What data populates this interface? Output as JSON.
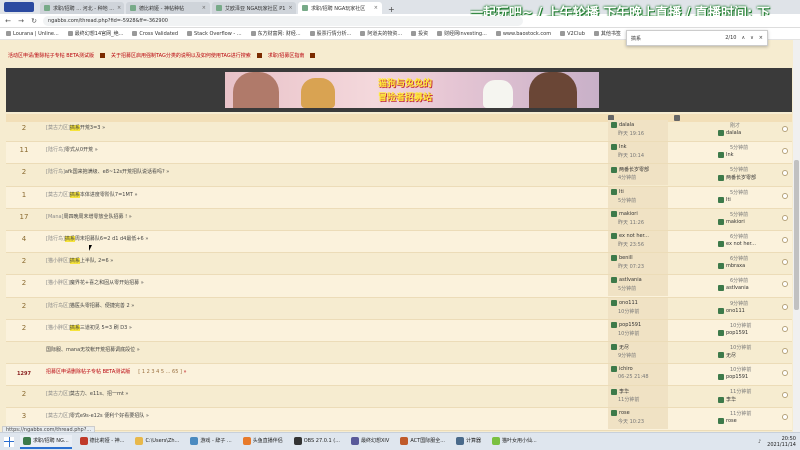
{
  "browser": {
    "tabs": [
      {
        "label": "求职/招聘 ... 河北 - 种地 ...",
        "active": false
      },
      {
        "label": "德比莉娅 - 神帖种帖",
        "active": false
      },
      {
        "label": "艾欧泽亚 NGA玩家社区 P1",
        "active": false
      },
      {
        "label": "求职/招聘 NGA玩家社区",
        "active": true
      }
    ],
    "url": "ngabbs.com/thread.php?fid=-5928&ff=-362900",
    "bookmarks": [
      "Lourana | Unline...",
      "最终幻想14官网_绝...",
      "Cross Validated",
      "Stack Overflow - ...",
      "东方财富网: 财经...",
      "股票行情分析...",
      "阿道夫的物资...",
      "投资",
      "财经网investing...",
      "www.baostock.com",
      "V2Club",
      "其他书签"
    ],
    "find": {
      "query": "搞系",
      "count": "2/10"
    }
  },
  "banner_text": "一起玩吧~ / 上午轮播 下午晚上直播 / 直播时间: 下",
  "forum": {
    "announcements": [
      "活动区申请/删除帖子专帖 BETA测试版",
      "关于招募区启用强制TAG分类的说明以及如何使用TAG进行搜索",
      "求职/招募区指南"
    ],
    "hero": {
      "line1": "猫狗与兔兔的",
      "line2": "冒险者招募站",
      "chip": "广告"
    }
  },
  "threads": [
    {
      "replies": "2",
      "prefix": "[莫古力区]",
      "highlight": "搞系",
      "rest": "开荒3=3",
      "author": "dalala",
      "author_time": "昨天 19:16",
      "reply_time": "刚才",
      "last_reply": "dalala"
    },
    {
      "replies": "11",
      "prefix": "[陆行鸟]",
      "highlight": "",
      "rest": "零式从0开荒",
      "author": "Ink",
      "author_time": "昨天 10:14",
      "reply_time": "5分钟前",
      "last_reply": "Ink"
    },
    {
      "replies": "2",
      "prefix": "[陆行鸟]",
      "highlight": "",
      "rest": "afk国来抱满级、e8~12s开荒招队说话看吗?",
      "author": "两番长岁零部",
      "author_time": "4分钟前",
      "reply_time": "5分钟前",
      "last_reply": "两番长岁零部"
    },
    {
      "replies": "1",
      "prefix": "[莫古力区]",
      "highlight": "搞系",
      "rest": "本体进度零阶队7=1MT",
      "author": "Iti",
      "author_time": "5分钟前",
      "reply_time": "5分钟前",
      "last_reply": "Iti"
    },
    {
      "replies": "17",
      "prefix": "[Mana]",
      "highlight": "",
      "rest": "周四晚周末增零放全队招募 !",
      "author": "makiori",
      "author_time": "昨天 11:26",
      "reply_time": "5分钟前",
      "last_reply": "makiori"
    },
    {
      "replies": "4",
      "prefix": "[陆行鸟]",
      "highlight": "搞系",
      "rest": "周末招募队6=2 d1 d4最低+6",
      "author": "ex not her...",
      "author_time": "昨天 23:56",
      "reply_time": "6分钟前",
      "last_reply": "ex not her..."
    },
    {
      "replies": "2",
      "prefix": "[猫小胖区]",
      "highlight": "搞系",
      "rest": "上半队, 2=6",
      "author": "benill",
      "author_time": "昨天 07:23",
      "reply_time": "6分钟前",
      "last_reply": "mbraxa"
    },
    {
      "replies": "2",
      "prefix": "[猫小胖区]",
      "highlight": "",
      "rest": "魔界花+喜之和固从零开始招募",
      "author": "astlvania",
      "author_time": "5分钟前",
      "reply_time": "6分钟前",
      "last_reply": "astlvania"
    },
    {
      "replies": "2",
      "prefix": "[陆行鸟区]",
      "highlight": "",
      "rest": "猫医头零招募、便捷完善 2",
      "author": "ono111",
      "author_time": "10分钟前",
      "reply_time": "9分钟前",
      "last_reply": "ono111"
    },
    {
      "replies": "2",
      "prefix": "[猫小胖区]",
      "highlight": "搞系",
      "rest": "三道初见 5=3 刷 D3",
      "author": "pop1591",
      "author_time": "10分钟前",
      "reply_time": "10分钟前",
      "last_reply": "pop1591"
    },
    {
      "replies": "",
      "prefix": "",
      "highlight": "",
      "rest": "国际服、mana无坟帐开荒招募调底段位",
      "author": "无尽",
      "author_time": "9分钟前",
      "reply_time": "10分钟前",
      "last_reply": "无尽"
    },
    {
      "replies": "1297",
      "prefix": "",
      "highlight": "",
      "rest": "招募区申请删除帖子专帖 BETA测试版",
      "pages": "[ 1 2 3 4 5 ... 65 ]",
      "red": true,
      "author": "ichiro",
      "author_time": "06-25 21:48",
      "reply_time": "10分钟前",
      "last_reply": "pop1591"
    },
    {
      "replies": "2",
      "prefix": "[莫古力区]",
      "highlight": "",
      "rest": "莫古力、e11s、招一mt",
      "author": "李华",
      "author_time": "11分钟前",
      "reply_time": "11分钟前",
      "last_reply": "李华"
    },
    {
      "replies": "3",
      "prefix": "[莫古力区]",
      "highlight": "",
      "rest": "零式e9s-e12s 便利个好看要招队",
      "author": "rose",
      "author_time": "今天 10:23",
      "reply_time": "11分钟前",
      "last_reply": "rose"
    }
  ],
  "status_url": "https://ngabbs.com/thread.php?...",
  "taskbar": {
    "items": [
      {
        "label": "求职/招聘 NG...",
        "color": "#3d7a4a",
        "active": true
      },
      {
        "label": "德比莉娅 - 神...",
        "color": "#c03a2a",
        "active": false
      },
      {
        "label": "C:\\Users\\Zh...",
        "color": "#e8b84a",
        "active": false
      },
      {
        "label": "游戏 - 辞子 ...",
        "color": "#4a8ac0",
        "active": false
      },
      {
        "label": "头鱼直播伴侣",
        "color": "#e87a2a",
        "active": false
      },
      {
        "label": "OBS 27.0.1 (...",
        "color": "#333333",
        "active": false
      },
      {
        "label": "最终幻想XIV",
        "color": "#5a5a9a",
        "active": false
      },
      {
        "label": "ACT国际服全...",
        "color": "#c05a2a",
        "active": false
      },
      {
        "label": "计算器",
        "color": "#4a6a8a",
        "active": false
      },
      {
        "label": "猫叶女用小仙...",
        "color": "#7ac040",
        "active": false
      }
    ],
    "time": "20:50",
    "date": "2021/11/14"
  }
}
